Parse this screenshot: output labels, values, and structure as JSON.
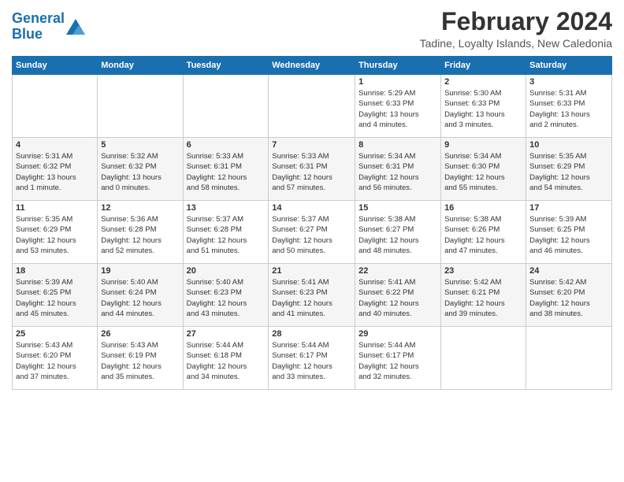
{
  "logo": {
    "line1": "General",
    "line2": "Blue"
  },
  "title": "February 2024",
  "subtitle": "Tadine, Loyalty Islands, New Caledonia",
  "calendar": {
    "headers": [
      "Sunday",
      "Monday",
      "Tuesday",
      "Wednesday",
      "Thursday",
      "Friday",
      "Saturday"
    ],
    "rows": [
      [
        {
          "day": "",
          "info": ""
        },
        {
          "day": "",
          "info": ""
        },
        {
          "day": "",
          "info": ""
        },
        {
          "day": "",
          "info": ""
        },
        {
          "day": "1",
          "info": "Sunrise: 5:29 AM\nSunset: 6:33 PM\nDaylight: 13 hours\nand 4 minutes."
        },
        {
          "day": "2",
          "info": "Sunrise: 5:30 AM\nSunset: 6:33 PM\nDaylight: 13 hours\nand 3 minutes."
        },
        {
          "day": "3",
          "info": "Sunrise: 5:31 AM\nSunset: 6:33 PM\nDaylight: 13 hours\nand 2 minutes."
        }
      ],
      [
        {
          "day": "4",
          "info": "Sunrise: 5:31 AM\nSunset: 6:32 PM\nDaylight: 13 hours\nand 1 minute."
        },
        {
          "day": "5",
          "info": "Sunrise: 5:32 AM\nSunset: 6:32 PM\nDaylight: 13 hours\nand 0 minutes."
        },
        {
          "day": "6",
          "info": "Sunrise: 5:33 AM\nSunset: 6:31 PM\nDaylight: 12 hours\nand 58 minutes."
        },
        {
          "day": "7",
          "info": "Sunrise: 5:33 AM\nSunset: 6:31 PM\nDaylight: 12 hours\nand 57 minutes."
        },
        {
          "day": "8",
          "info": "Sunrise: 5:34 AM\nSunset: 6:31 PM\nDaylight: 12 hours\nand 56 minutes."
        },
        {
          "day": "9",
          "info": "Sunrise: 5:34 AM\nSunset: 6:30 PM\nDaylight: 12 hours\nand 55 minutes."
        },
        {
          "day": "10",
          "info": "Sunrise: 5:35 AM\nSunset: 6:29 PM\nDaylight: 12 hours\nand 54 minutes."
        }
      ],
      [
        {
          "day": "11",
          "info": "Sunrise: 5:35 AM\nSunset: 6:29 PM\nDaylight: 12 hours\nand 53 minutes."
        },
        {
          "day": "12",
          "info": "Sunrise: 5:36 AM\nSunset: 6:28 PM\nDaylight: 12 hours\nand 52 minutes."
        },
        {
          "day": "13",
          "info": "Sunrise: 5:37 AM\nSunset: 6:28 PM\nDaylight: 12 hours\nand 51 minutes."
        },
        {
          "day": "14",
          "info": "Sunrise: 5:37 AM\nSunset: 6:27 PM\nDaylight: 12 hours\nand 50 minutes."
        },
        {
          "day": "15",
          "info": "Sunrise: 5:38 AM\nSunset: 6:27 PM\nDaylight: 12 hours\nand 48 minutes."
        },
        {
          "day": "16",
          "info": "Sunrise: 5:38 AM\nSunset: 6:26 PM\nDaylight: 12 hours\nand 47 minutes."
        },
        {
          "day": "17",
          "info": "Sunrise: 5:39 AM\nSunset: 6:25 PM\nDaylight: 12 hours\nand 46 minutes."
        }
      ],
      [
        {
          "day": "18",
          "info": "Sunrise: 5:39 AM\nSunset: 6:25 PM\nDaylight: 12 hours\nand 45 minutes."
        },
        {
          "day": "19",
          "info": "Sunrise: 5:40 AM\nSunset: 6:24 PM\nDaylight: 12 hours\nand 44 minutes."
        },
        {
          "day": "20",
          "info": "Sunrise: 5:40 AM\nSunset: 6:23 PM\nDaylight: 12 hours\nand 43 minutes."
        },
        {
          "day": "21",
          "info": "Sunrise: 5:41 AM\nSunset: 6:23 PM\nDaylight: 12 hours\nand 41 minutes."
        },
        {
          "day": "22",
          "info": "Sunrise: 5:41 AM\nSunset: 6:22 PM\nDaylight: 12 hours\nand 40 minutes."
        },
        {
          "day": "23",
          "info": "Sunrise: 5:42 AM\nSunset: 6:21 PM\nDaylight: 12 hours\nand 39 minutes."
        },
        {
          "day": "24",
          "info": "Sunrise: 5:42 AM\nSunset: 6:20 PM\nDaylight: 12 hours\nand 38 minutes."
        }
      ],
      [
        {
          "day": "25",
          "info": "Sunrise: 5:43 AM\nSunset: 6:20 PM\nDaylight: 12 hours\nand 37 minutes."
        },
        {
          "day": "26",
          "info": "Sunrise: 5:43 AM\nSunset: 6:19 PM\nDaylight: 12 hours\nand 35 minutes."
        },
        {
          "day": "27",
          "info": "Sunrise: 5:44 AM\nSunset: 6:18 PM\nDaylight: 12 hours\nand 34 minutes."
        },
        {
          "day": "28",
          "info": "Sunrise: 5:44 AM\nSunset: 6:17 PM\nDaylight: 12 hours\nand 33 minutes."
        },
        {
          "day": "29",
          "info": "Sunrise: 5:44 AM\nSunset: 6:17 PM\nDaylight: 12 hours\nand 32 minutes."
        },
        {
          "day": "",
          "info": ""
        },
        {
          "day": "",
          "info": ""
        }
      ]
    ]
  }
}
